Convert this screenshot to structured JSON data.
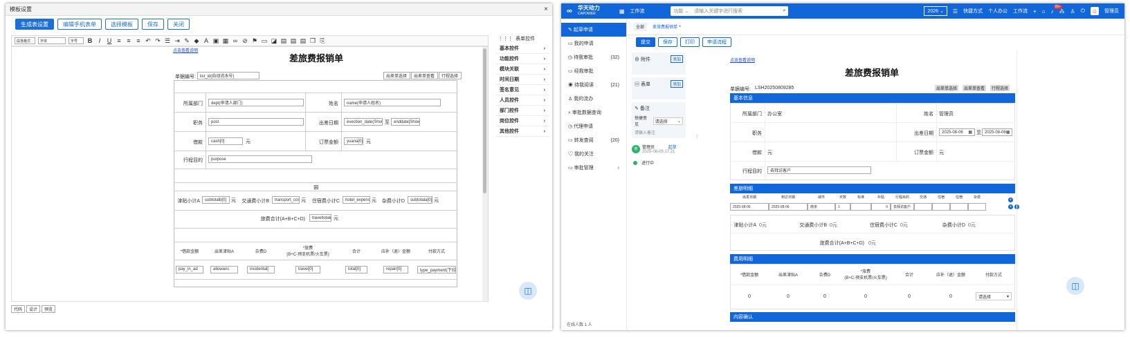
{
  "left": {
    "title": "模板设置",
    "buttons": [
      "生成表设置",
      "编辑手机表单",
      "选择模板",
      "保存",
      "关闭"
    ],
    "toolbar_selects": [
      "段落格式",
      "字体",
      "字号"
    ],
    "link": "点击查看说明",
    "form_title": "差旅费报销单",
    "docno_label": "单据编号:",
    "docno_value": "list_id(自动流水号)",
    "top_buttons": [
      "出差单选择",
      "出差单查看",
      "行程选择"
    ],
    "rows": [
      {
        "l1": "所属部门",
        "v1": "dept(申请人部门)",
        "l2": "姓名",
        "v2": "name(申请人姓名)"
      },
      {
        "l1": "职务",
        "v1": "post",
        "l2": "出差日期",
        "v2": "evection_date(Show[",
        "mid": "至",
        "v3": "enddate[Show"
      },
      {
        "l1": "借款",
        "v1": "cash[0]",
        "u1": "元",
        "l2": "订票金额",
        "v2": "yuana[0]",
        "u2": "元"
      },
      {
        "l1": "行程目的",
        "v1": "purpose"
      }
    ],
    "subtotals": [
      {
        "l": "津贴小计A",
        "v": "subtotalb[0]",
        "u": "元"
      },
      {
        "l": "交通费小计B",
        "v": "transport_cost",
        "u": "元"
      },
      {
        "l": "住宿费小计C",
        "v": "hotel_expense",
        "u": "元"
      },
      {
        "l": "杂费小计D",
        "v": "subtotala[0]",
        "u": "元"
      }
    ],
    "total_label": "旅费合计(A+B+C+D)",
    "total_value": "traveltotal(",
    "total_unit": "元",
    "grid_headers": [
      "*借款金额",
      "出差津贴A",
      "杂费D",
      "*旅费\n(B+C-预支机票/火车票)",
      "合计",
      "应补（退）金额",
      "付款方式"
    ],
    "grid_values": [
      "pay_in_ad",
      "allowanc",
      "incidental[",
      "travel[0]",
      "total[0]",
      "repair[0]",
      "type_payment(下拉"
    ],
    "panel_title": "表单控件",
    "panel_items": [
      "基本控件",
      "功能控件",
      "模块关联",
      "时间日期",
      "签名意见",
      "人员控件",
      "部门控件",
      "岗位控件",
      "其他控件"
    ],
    "footer_tabs": [
      "代码",
      "设计",
      "预览"
    ]
  },
  "right": {
    "brand": "华天动力",
    "brand_sub": "CAPOWER",
    "nav_title": "工作流",
    "search_prefix": "功能",
    "search_placeholder": "请输入关键字进行搜索",
    "year": "2026",
    "top_links": [
      "快捷方式",
      "个人办公",
      "工作流"
    ],
    "badge": "99+",
    "user": "管理员",
    "sidebar": [
      {
        "label": "起草申请",
        "count": ""
      },
      {
        "label": "我的申请",
        "count": ""
      },
      {
        "label": "待我审批",
        "count": "(32)"
      },
      {
        "label": "经我审批",
        "count": ""
      },
      {
        "label": "待我阅读",
        "count": "(21)"
      },
      {
        "label": "我的流办",
        "count": ""
      },
      {
        "label": "审批数据查询",
        "count": ""
      },
      {
        "label": "代理申请",
        "count": ""
      },
      {
        "label": "转发查阅",
        "count": "(20)"
      },
      {
        "label": "我的关注",
        "count": ""
      },
      {
        "label": "审批管理",
        "count": ""
      }
    ],
    "online": "在线人数 1 人",
    "tabs": [
      "全部",
      "差旅费报销单"
    ],
    "actions": [
      "提交",
      "保存",
      "打印",
      "申请流程"
    ],
    "attach_label": "附件",
    "attach_btn": "添加",
    "table_label": "表单",
    "table_btn": "添加",
    "remark_label": "备注",
    "quick_label": "快捷意见",
    "quick_value": "请选择",
    "remark_placeholder": "请输入备注",
    "flow_user": "管理员",
    "flow_badge": "起草",
    "flow_time": "2025-08-09 17:21",
    "flow_state": "进行中",
    "link": "点击查看说明",
    "form_title": "差旅费报销单",
    "docno_label": "单据编号:",
    "docno_value": "LSH20250809285",
    "top_buttons": [
      "出差单选择",
      "出差单查看",
      "行程选择"
    ],
    "sec_basic": "基本信息",
    "f_dept_l": "所属部门",
    "f_dept_v": "办公室",
    "f_name_l": "姓名",
    "f_name_v": "管理员",
    "f_post_l": "职务",
    "f_date_l": "出差日期",
    "f_date1": "2025-08-06",
    "f_mid": "至",
    "f_date2": "2025-08-06",
    "f_cash_l": "借款",
    "f_cash_u": "元",
    "f_ticket_l": "订票金额",
    "f_ticket_u": "元",
    "f_purpose_l": "行程目的",
    "f_purpose_v": "去拜访客户",
    "sec_detail": "差旅明细",
    "detail_headers": [
      "出发日期",
      "到达日期",
      "城市",
      "天数",
      "标准",
      "补贴",
      "行程目的",
      "交通",
      "住宿",
      "住宿",
      "杂费"
    ],
    "detail_row": [
      "2025-08-06",
      "2025-08-06",
      "南京",
      "1",
      "",
      "0",
      "去拜访客户",
      "",
      "",
      "",
      ""
    ],
    "subtotals": [
      {
        "l": "津贴小计A",
        "v": "0元"
      },
      {
        "l": "交通费小计B",
        "v": "0元"
      },
      {
        "l": "住宿费小计C",
        "v": "0元"
      },
      {
        "l": "杂费小计D",
        "v": "0元"
      }
    ],
    "total_label": "旅费合计(A+B+C+D)",
    "total_value": "0元",
    "sec_cost": "费用明细",
    "grid_headers": [
      "*借款金额",
      "出差津贴A",
      "杂费D",
      "*旅费\n(B+C-预支机票/火车票)",
      "合计",
      "应补（退）金额",
      "付款方式"
    ],
    "grid_values": [
      "0",
      "0",
      "0",
      "0",
      "0",
      "0",
      "请选择"
    ],
    "sec_more": "内容确认"
  }
}
